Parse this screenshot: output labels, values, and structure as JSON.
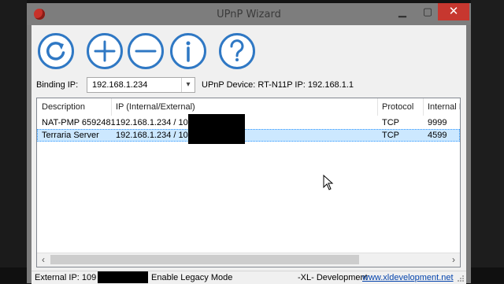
{
  "window": {
    "title": "UPnP Wizard",
    "controls": {
      "minimize": "▁",
      "maximize": "▢",
      "close": "✕"
    }
  },
  "toolbar": {
    "buttons": [
      {
        "name": "refresh",
        "icon": "refresh-icon"
      },
      {
        "name": "add",
        "icon": "plus-icon"
      },
      {
        "name": "remove",
        "icon": "minus-icon"
      },
      {
        "name": "info",
        "icon": "info-icon"
      },
      {
        "name": "help",
        "icon": "help-icon"
      }
    ],
    "accent_color": "#2f78c4"
  },
  "binding": {
    "label": "Binding IP:",
    "value": "192.168.1.234",
    "device": "UPnP Device: RT-N11P IP: 192.168.1.1"
  },
  "table": {
    "columns": [
      "Description",
      "IP (Internal/External)",
      "Protocol",
      "Internal I"
    ],
    "rows": [
      {
        "description": "NAT-PMP 6592481",
        "ip": "192.168.1.234 / 109",
        "protocol": "TCP",
        "internal": "9999",
        "selected": false
      },
      {
        "description": "Terraria Server",
        "ip": "192.168.1.234 / 109",
        "protocol": "TCP",
        "internal": "4599",
        "selected": true
      }
    ],
    "selection_color": "#cce8ff"
  },
  "status": {
    "external_ip": "External IP: 109",
    "legacy_mode": "Enable Legacy Mode",
    "developer": "-XL- Development",
    "link": "www.xldevelopment.net"
  }
}
